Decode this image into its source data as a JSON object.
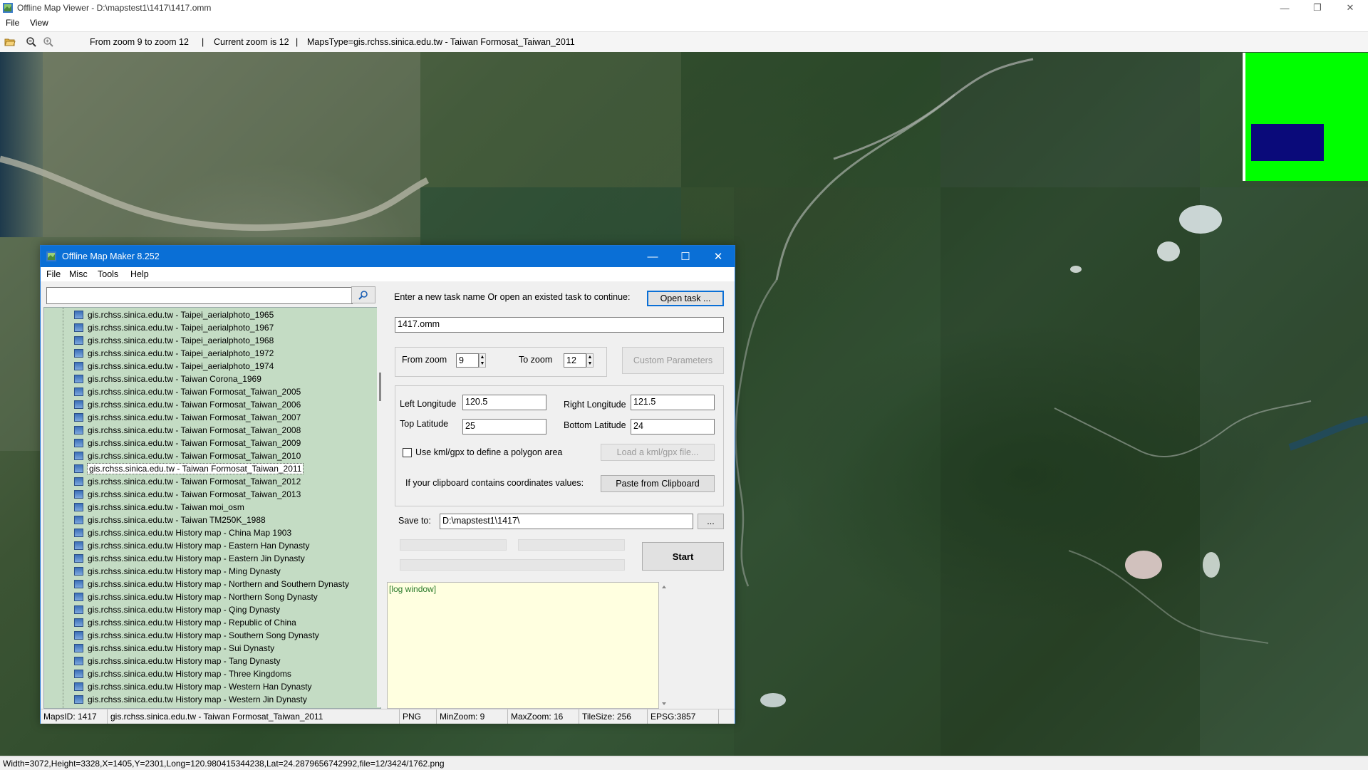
{
  "viewer": {
    "title": "Offline Map Viewer - D:\\mapstest1\\1417\\1417.omm",
    "menu": [
      "File",
      "View"
    ],
    "toolbar_info": {
      "zoom_range": "From zoom 9 to zoom 12",
      "sep1": "|",
      "current_zoom": "Current zoom is 12",
      "sep2": "|",
      "maps_type": "MapsType=gis.rchss.sinica.edu.tw - Taiwan Formosat_Taiwan_2011"
    },
    "status": "Width=3072,Height=3328,X=1405,Y=2301,Long=120.980415344238,Lat=24.2879656742992,file=12/3424/1762.png",
    "window_buttons": {
      "minimize": "—",
      "restore": "❐",
      "close": "✕"
    }
  },
  "dialog": {
    "title": "Offline Map Maker 8.252",
    "menu": [
      "File",
      "Misc",
      "Tools",
      "Help"
    ],
    "window_buttons": {
      "minimize": "—",
      "maximize": "☐",
      "close": "✕"
    },
    "search": {
      "value": ""
    },
    "tree_items": [
      "gis.rchss.sinica.edu.tw - Taipei_aerialphoto_1965",
      "gis.rchss.sinica.edu.tw - Taipei_aerialphoto_1967",
      "gis.rchss.sinica.edu.tw - Taipei_aerialphoto_1968",
      "gis.rchss.sinica.edu.tw - Taipei_aerialphoto_1972",
      "gis.rchss.sinica.edu.tw - Taipei_aerialphoto_1974",
      "gis.rchss.sinica.edu.tw - Taiwan Corona_1969",
      "gis.rchss.sinica.edu.tw - Taiwan Formosat_Taiwan_2005",
      "gis.rchss.sinica.edu.tw - Taiwan Formosat_Taiwan_2006",
      "gis.rchss.sinica.edu.tw - Taiwan Formosat_Taiwan_2007",
      "gis.rchss.sinica.edu.tw - Taiwan Formosat_Taiwan_2008",
      "gis.rchss.sinica.edu.tw - Taiwan Formosat_Taiwan_2009",
      "gis.rchss.sinica.edu.tw - Taiwan Formosat_Taiwan_2010",
      "gis.rchss.sinica.edu.tw - Taiwan Formosat_Taiwan_2011",
      "gis.rchss.sinica.edu.tw - Taiwan Formosat_Taiwan_2012",
      "gis.rchss.sinica.edu.tw - Taiwan Formosat_Taiwan_2013",
      "gis.rchss.sinica.edu.tw - Taiwan moi_osm",
      "gis.rchss.sinica.edu.tw - Taiwan TM250K_1988",
      "gis.rchss.sinica.edu.tw History map - China Map 1903",
      "gis.rchss.sinica.edu.tw History map - Eastern Han Dynasty",
      "gis.rchss.sinica.edu.tw History map - Eastern Jin Dynasty",
      "gis.rchss.sinica.edu.tw History map - Ming Dynasty",
      "gis.rchss.sinica.edu.tw History map - Northern and Southern Dynasty",
      "gis.rchss.sinica.edu.tw History map - Northern Song Dynasty",
      "gis.rchss.sinica.edu.tw History map - Qing Dynasty",
      "gis.rchss.sinica.edu.tw History map - Republic of China",
      "gis.rchss.sinica.edu.tw History map - Southern Song Dynasty",
      "gis.rchss.sinica.edu.tw History map - Sui Dynasty",
      "gis.rchss.sinica.edu.tw History map - Tang Dynasty",
      "gis.rchss.sinica.edu.tw History map - Three Kingdoms",
      "gis.rchss.sinica.edu.tw History map - Western Han Dynasty",
      "gis.rchss.sinica.edu.tw History map - Western Jin Dynasty"
    ],
    "selected_index": 12,
    "task": {
      "prompt": "Enter a new task name Or open an existed task to continue:",
      "open_button": "Open task ...",
      "name": "1417.omm"
    },
    "zoom": {
      "from_label": "From zoom",
      "from_value": "9",
      "to_label": "To zoom",
      "to_value": "12",
      "custom_button": "Custom Parameters"
    },
    "coords": {
      "left_lon_label": "Left Longitude",
      "left_lon": "120.5",
      "right_lon_label": "Right Longitude",
      "right_lon": "121.5",
      "top_lat_label": "Top Latitude",
      "top_lat": "25",
      "bottom_lat_label": "Bottom Latitude",
      "bottom_lat": "24",
      "kml_checkbox": "Use kml/gpx to define a polygon area",
      "kml_button": "Load a kml/gpx file...",
      "clipboard_label": "If your clipboard contains coordinates values:",
      "clipboard_button": "Paste from Clipboard"
    },
    "save": {
      "label": "Save to:",
      "path": "D:\\mapstest1\\1417\\",
      "browse": "...",
      "start": "Start"
    },
    "log": "[log window]",
    "status": {
      "maps_id": "MapsID: 1417",
      "map_name": "gis.rchss.sinica.edu.tw - Taiwan Formosat_Taiwan_2011",
      "format": "PNG",
      "min_zoom": "MinZoom: 9",
      "max_zoom": "MaxZoom: 16",
      "tile_size": "TileSize: 256",
      "epsg": "EPSG:3857"
    }
  },
  "colors": {
    "dialog_title_bar": "#0a6fd6",
    "tree_background": "#c4dcc4",
    "log_background": "#ffffe0",
    "minimap_green": "#00ff00",
    "minimap_viewport": "#0a0a7a"
  }
}
